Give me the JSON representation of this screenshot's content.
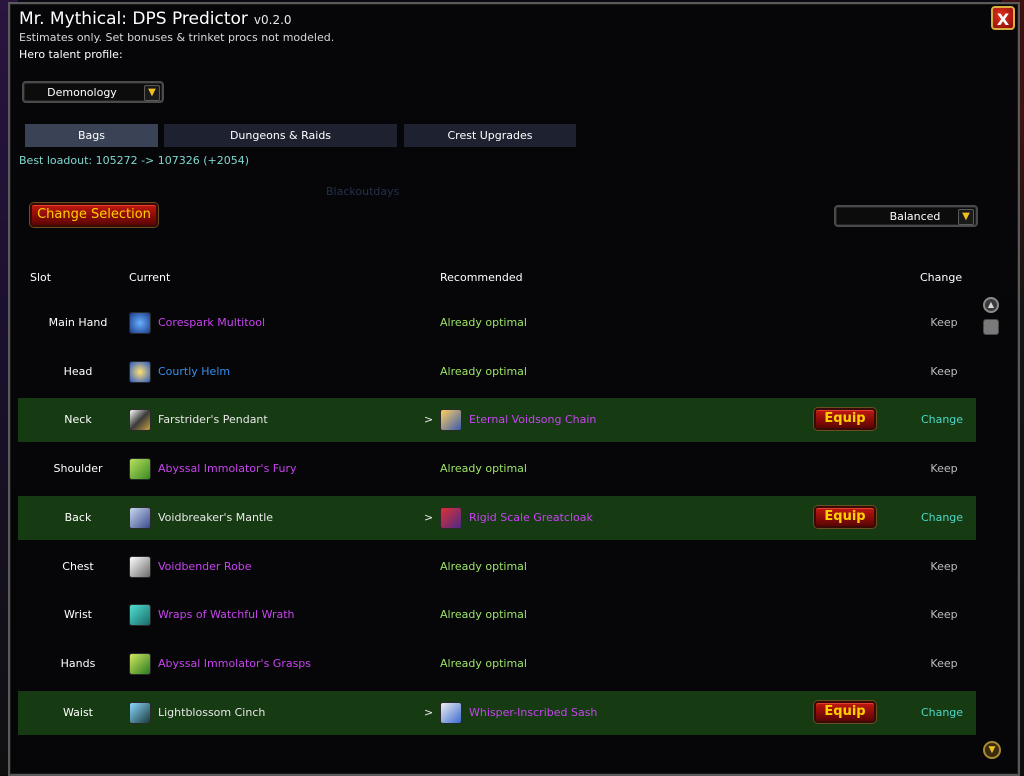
{
  "window": {
    "title": "Mr. Mythical: DPS Predictor",
    "version": "v0.2.0",
    "subtitle": "Estimates only. Set bonuses & trinket procs not modeled.",
    "hero_label": "Hero talent profile:",
    "close_glyph": "X"
  },
  "spec_dropdown": {
    "value": "Demonology",
    "arrow": "▼"
  },
  "tabs": [
    {
      "label": "Bags",
      "active": true
    },
    {
      "label": "Dungeons & Raids",
      "active": false
    },
    {
      "label": "Crest Upgrades",
      "active": false
    }
  ],
  "best_loadout": "Best loadout: 105272 -> 107326 (+2054)",
  "faint_text": "Blackoutdays",
  "change_selection_label": "Change Selection",
  "mode_dropdown": {
    "value": "Balanced",
    "arrow": "▼"
  },
  "columns": {
    "slot": "Slot",
    "current": "Current",
    "recommended": "Recommended",
    "change": "Change"
  },
  "rows": [
    {
      "slot": "Main Hand",
      "current": "Corespark Multitool",
      "current_quality": "epic",
      "current_icon": "blue-gear-icon",
      "upgrade": false,
      "recommended": "Already optimal",
      "change": "Keep"
    },
    {
      "slot": "Head",
      "current": "Courtly Helm",
      "current_quality": "rare",
      "current_icon": "gold-helm-icon",
      "upgrade": false,
      "recommended": "Already optimal",
      "change": "Keep"
    },
    {
      "slot": "Neck",
      "current": "Farstrider's Pendant",
      "current_quality": "common",
      "current_icon": "pendant-icon",
      "upgrade": true,
      "arrow": ">",
      "recommended": "Eternal Voidsong Chain",
      "recommended_quality": "epic",
      "rec_icon": "chain-icon",
      "equip": "Equip",
      "change": "Change"
    },
    {
      "slot": "Shoulder",
      "current": "Abyssal Immolator's Fury",
      "current_quality": "epic",
      "current_icon": "green-shoulder-icon",
      "upgrade": false,
      "recommended": "Already optimal",
      "change": "Keep"
    },
    {
      "slot": "Back",
      "current": "Voidbreaker's Mantle",
      "current_quality": "common",
      "current_icon": "cloak-icon",
      "upgrade": true,
      "arrow": ">",
      "recommended": "Rigid Scale Greatcloak",
      "recommended_quality": "epic",
      "rec_icon": "red-cloak-icon",
      "equip": "Equip",
      "change": "Change"
    },
    {
      "slot": "Chest",
      "current": "Voidbender Robe",
      "current_quality": "epic",
      "current_icon": "robe-icon",
      "upgrade": false,
      "recommended": "Already optimal",
      "change": "Keep"
    },
    {
      "slot": "Wrist",
      "current": "Wraps of Watchful Wrath",
      "current_quality": "epic",
      "current_icon": "teal-wraps-icon",
      "upgrade": false,
      "recommended": "Already optimal",
      "change": "Keep"
    },
    {
      "slot": "Hands",
      "current": "Abyssal Immolator's Grasps",
      "current_quality": "epic",
      "current_icon": "green-gloves-icon",
      "upgrade": false,
      "recommended": "Already optimal",
      "change": "Keep"
    },
    {
      "slot": "Waist",
      "current": "Lightblossom Cinch",
      "current_quality": "common",
      "current_icon": "belt-icon",
      "upgrade": true,
      "arrow": ">",
      "recommended": "Whisper-Inscribed Sash",
      "recommended_quality": "epic",
      "rec_icon": "sash-icon",
      "equip": "Equip",
      "change": "Change"
    }
  ],
  "scrollbar": {
    "up_glyph": "▲",
    "down_glyph": "▼"
  },
  "colors": {
    "epic": "#c844f0",
    "rare": "#3a8ee8",
    "optimal": "#9ee46a",
    "change": "#4ed8c8",
    "upgrade_row": "#163a12",
    "button_text": "#ffd100"
  }
}
